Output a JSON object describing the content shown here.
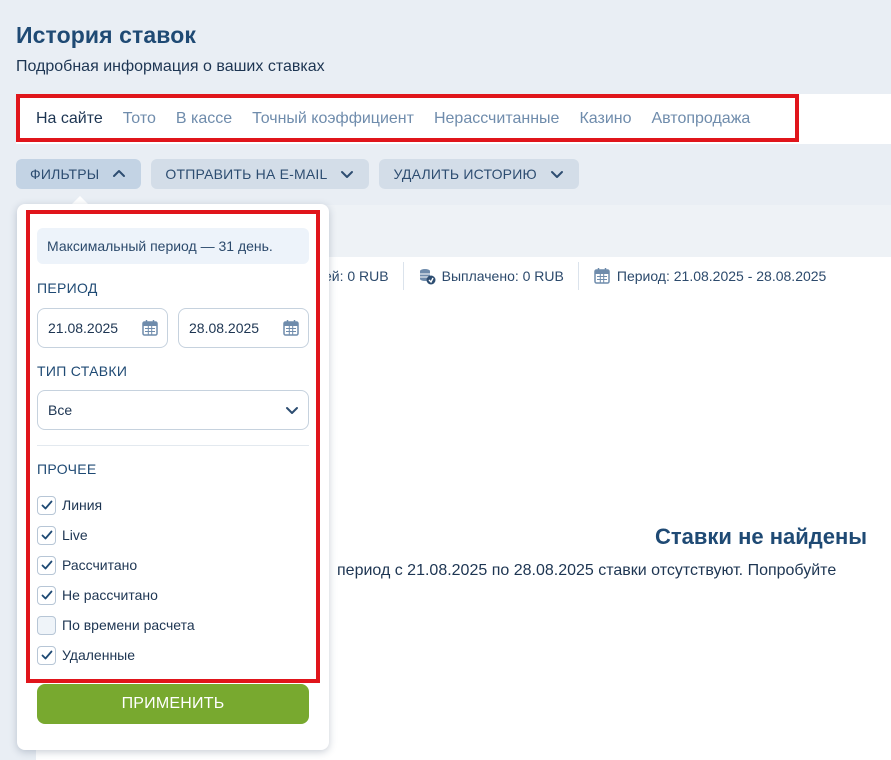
{
  "header": {
    "title": "История ставок",
    "subtitle": "Подробная информация о ваших ставках"
  },
  "tabs": [
    {
      "label": "На сайте",
      "active": true
    },
    {
      "label": "Тото",
      "active": false
    },
    {
      "label": "В кассе",
      "active": false
    },
    {
      "label": "Точный коэффициент",
      "active": false
    },
    {
      "label": "Нерассчитанные",
      "active": false
    },
    {
      "label": "Казино",
      "active": false
    },
    {
      "label": "Автопродажа",
      "active": false
    }
  ],
  "toolbar": {
    "filters_label": "ФИЛЬТРЫ",
    "email_label": "ОТПРАВИТЬ НА E-MAIL",
    "delete_label": "УДАЛИТЬ ИСТОРИЮ"
  },
  "stats": {
    "first": "ей: 0 RUB",
    "paid": "Выплачено: 0 RUB",
    "period": "Период: 21.08.2025 - 28.08.2025"
  },
  "empty": {
    "title": "Ставки не найдены",
    "text": "период с 21.08.2025 по 28.08.2025 ставки отсутствуют. Попробуйте"
  },
  "filters": {
    "notice": "Максимальный период — 31 день.",
    "period_label": "ПЕРИОД",
    "date_from": "21.08.2025",
    "date_to": "28.08.2025",
    "bet_type_label": "ТИП СТАВКИ",
    "bet_type_value": "Все",
    "other_label": "ПРОЧЕЕ",
    "checks": [
      {
        "label": "Линия",
        "checked": true
      },
      {
        "label": "Live",
        "checked": true
      },
      {
        "label": "Рассчитано",
        "checked": true
      },
      {
        "label": "Не рассчитано",
        "checked": true
      },
      {
        "label": "По времени расчета",
        "checked": false
      },
      {
        "label": "Удаленные",
        "checked": true
      }
    ],
    "apply_label": "ПРИМЕНИТЬ"
  },
  "colors": {
    "accent_green": "#78a92f",
    "highlight_red": "#e0151b",
    "title_blue": "#1f4a74"
  }
}
